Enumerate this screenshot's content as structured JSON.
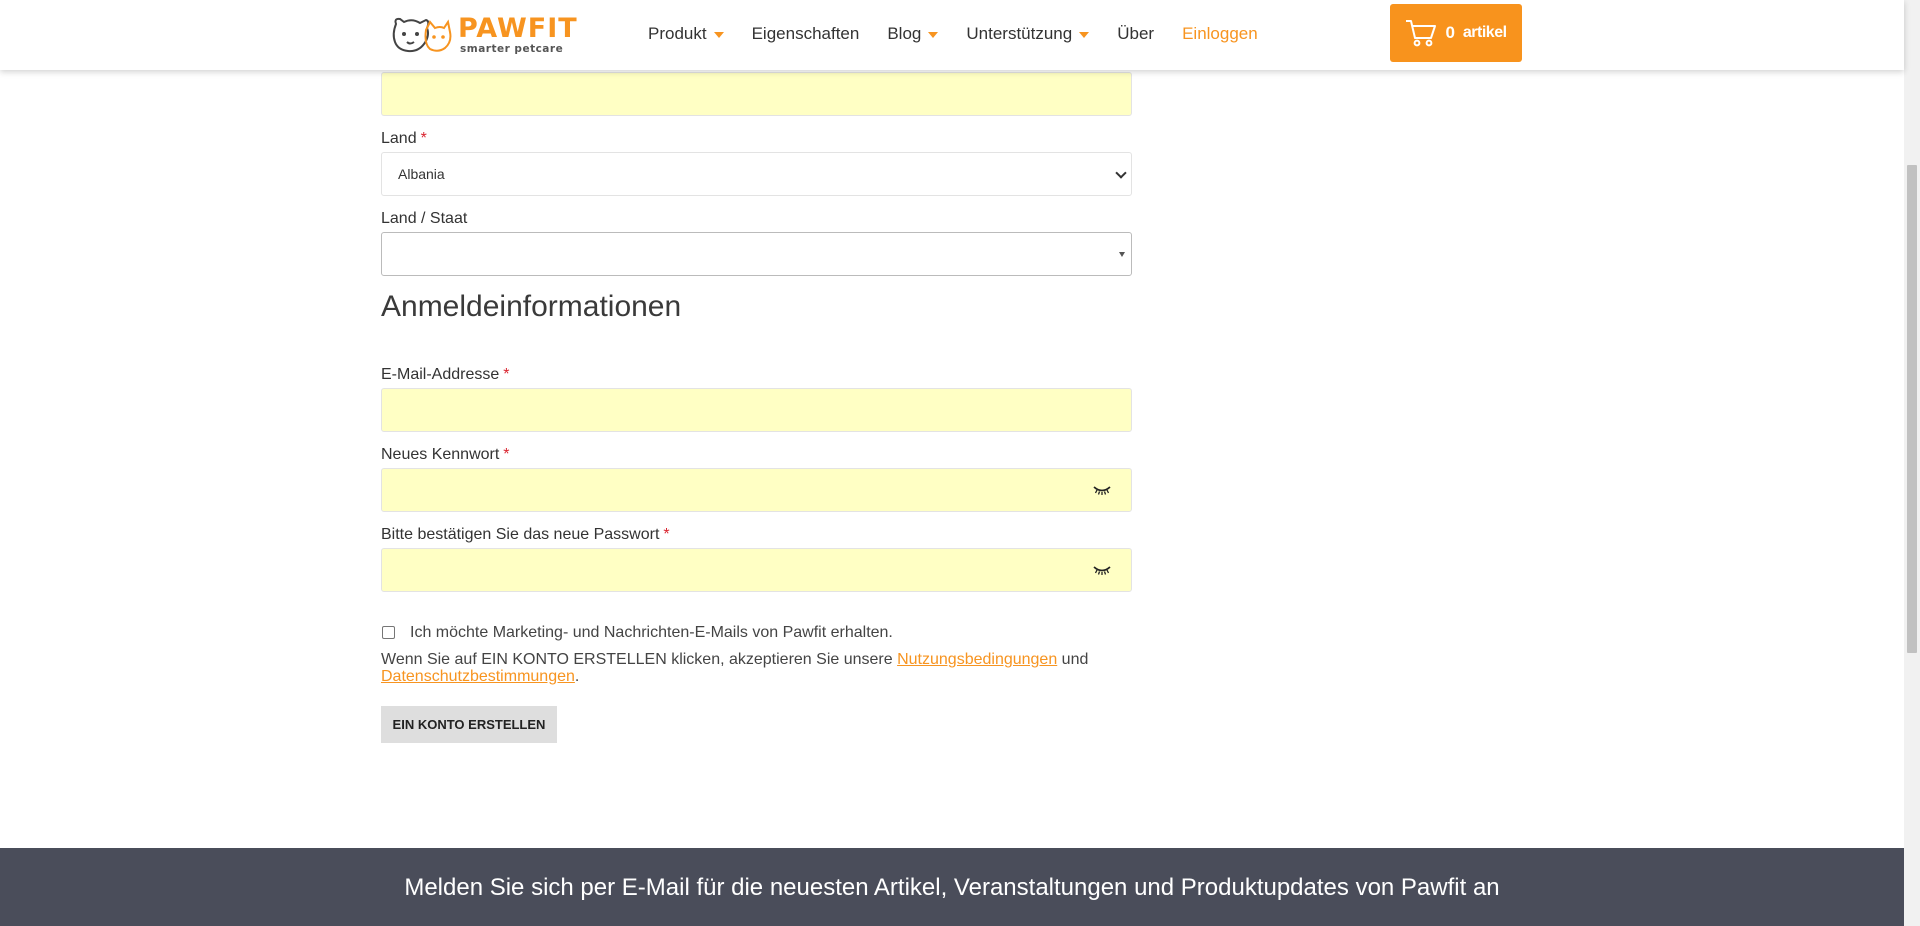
{
  "header": {
    "logo": {
      "word": "PAWFIT",
      "tagline": "smarter petcare"
    },
    "nav": [
      {
        "label": "Produkt",
        "dropdown": true
      },
      {
        "label": "Eigenschaften",
        "dropdown": false
      },
      {
        "label": "Blog",
        "dropdown": true
      },
      {
        "label": "Unterstützung",
        "dropdown": true
      },
      {
        "label": "Über",
        "dropdown": false
      },
      {
        "label": "Einloggen",
        "dropdown": false
      }
    ],
    "cart": {
      "count": "0",
      "label": "artikel",
      "icon": "cart-icon"
    }
  },
  "form": {
    "country": {
      "label": "Land",
      "required": "*",
      "value": "Albania"
    },
    "state": {
      "label": "Land / Staat",
      "value": ""
    },
    "login_section_title": "Anmeldeinformationen",
    "email": {
      "label": "E-Mail-Addresse",
      "required": "*",
      "value": ""
    },
    "password": {
      "label": "Neues Kennwort",
      "required": "*",
      "value": "",
      "icon": "eye-closed-icon"
    },
    "confirm_password": {
      "label": "Bitte bestätigen Sie das neue Passwort",
      "required": "*",
      "value": "",
      "icon": "eye-closed-icon"
    },
    "marketing_checkbox": {
      "label": "Ich möchte Marketing- und Nachrichten-E-Mails von Pawfit erhalten.",
      "checked": false
    },
    "terms": {
      "prefix": "Wenn Sie auf EIN KONTO ERSTELLEN klicken, akzeptieren Sie unsere ",
      "terms_link": "Nutzungsbedingungen",
      "middle": " und ",
      "privacy_link": "Datenschutzbestimmungen",
      "suffix": "."
    },
    "submit_label": "EIN KONTO ERSTELLEN"
  },
  "footer": {
    "newsletter_text": "Melden Sie sich per E-Mail für die neuesten Artikel, Veranstaltungen und Produktupdates von Pawfit an"
  },
  "colors": {
    "accent": "#f79420",
    "field_autofill": "#ffffc4",
    "footer_bg": "#4a4d5a",
    "required": "#d9232e"
  }
}
